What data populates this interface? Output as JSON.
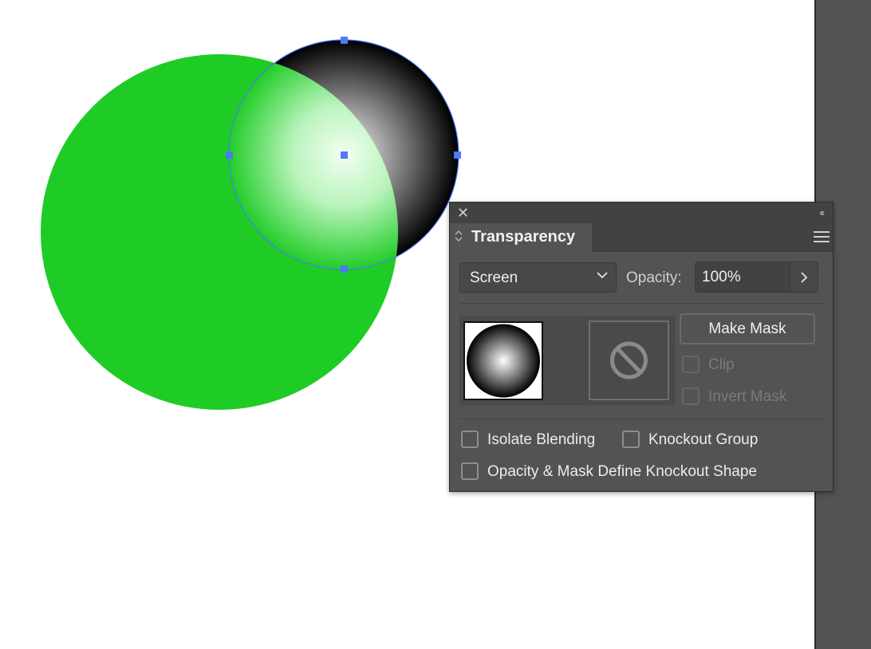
{
  "canvas": {
    "shapes": [
      {
        "name": "green-circle",
        "fill": "#1fcc26"
      },
      {
        "name": "radial-gradient-circle",
        "gradient": [
          "#ffffff",
          "#000000"
        ],
        "selected": true,
        "blend_mode": "Screen"
      }
    ],
    "selection_color": "#4b7bf5"
  },
  "panel": {
    "close_glyph": "✕",
    "collapse_glyph": "‹‹",
    "tab_arrows": "◇",
    "title": "Transparency",
    "blend_mode": "Screen",
    "opacity_label": "Opacity:",
    "opacity_value": "100%",
    "make_mask_label": "Make Mask",
    "clip_label": "Clip",
    "invert_mask_label": "Invert Mask",
    "isolate_blending_label": "Isolate Blending",
    "knockout_group_label": "Knockout Group",
    "opacity_mask_knockout_label": "Opacity & Mask Define Knockout Shape",
    "checkboxes": {
      "clip": false,
      "invert_mask": false,
      "isolate_blending": false,
      "knockout_group": false,
      "opacity_mask_knockout": false
    }
  },
  "colors": {
    "panel_bg": "#535353",
    "panel_header": "#424242",
    "pasteboard": "#535353",
    "green": "#1fcc26",
    "selection": "#4b7bf5"
  }
}
